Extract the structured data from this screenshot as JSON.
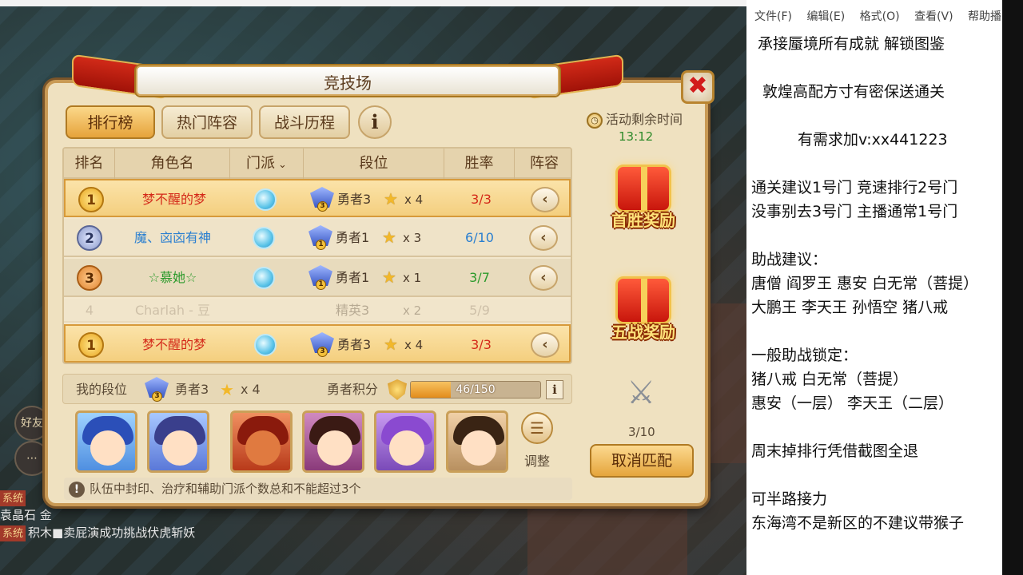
{
  "game": {
    "chat": [
      {
        "tag": "系统",
        "text": ""
      },
      {
        "tag": "",
        "text": "袁晶石 金"
      },
      {
        "tag": "系统",
        "text": "积木■卖屁演成功挑战伏虎斩妖"
      }
    ],
    "side_buttons": [
      "好友"
    ]
  },
  "dialog": {
    "title": "竞技场",
    "close_label": "✖",
    "tabs": [
      {
        "label": "排行榜",
        "active": true
      },
      {
        "label": "热门阵容",
        "active": false
      },
      {
        "label": "战斗历程",
        "active": false
      }
    ],
    "info_label": "i",
    "table": {
      "headers": [
        "排名",
        "角色名",
        "门派",
        "段位",
        "胜率",
        "阵容"
      ],
      "school_sort_icon": "chevron-down-icon",
      "rows": [
        {
          "rank": "1",
          "name": "梦不醒的梦",
          "name_color": "#d42a1a",
          "rank_title": "勇者3",
          "badge": "3",
          "stars": "x  4",
          "winrate": "3/3",
          "winrate_color": "#d42a1a"
        },
        {
          "rank": "2",
          "name": "魔、㐫㐫有神",
          "name_color": "#2a7fd0",
          "rank_title": "勇者1",
          "badge": "1",
          "stars": "x  3",
          "winrate": "6/10",
          "winrate_color": "#2a7fd0"
        },
        {
          "rank": "3",
          "name": "☆慕她☆",
          "name_color": "#2c9a2c",
          "rank_title": "勇者1",
          "badge": "1",
          "stars": "x  1",
          "winrate": "3/7",
          "winrate_color": "#2c9a2c"
        },
        {
          "rank": "4",
          "name": "Charlah - 豆",
          "name_color": "#8a7a66",
          "rank_title": "精英3",
          "badge": "3",
          "stars": "x  2",
          "winrate": "5/9",
          "winrate_color": "#8a7a66"
        }
      ],
      "my_row": {
        "rank": "1",
        "name": "梦不醒的梦",
        "rank_title": "勇者3",
        "badge": "3",
        "stars": "x  4",
        "winrate": "3/3"
      }
    },
    "my_rank": {
      "label": "我的段位",
      "rank_title": "勇者3",
      "stars": "x  4",
      "points_label": "勇者积分",
      "progress_text": "46/150",
      "progress_value": 0.3067,
      "info_label": "i"
    },
    "adjust_label": "调整",
    "tip": "队伍中封印、治疗和辅助门派个数总和不能超过3个",
    "timer_label": "活动剩余时间",
    "timer_value": "13:12",
    "reward_first": "首胜奖励",
    "reward_five": "五战奖励",
    "battle_count": "3/10",
    "cancel_label": "取消匹配",
    "colors": {
      "accent": "#e5a53c",
      "ribbon": "#c8160c",
      "panel": "#efe1c0"
    }
  },
  "notepad": {
    "menu": [
      "文件(F)",
      "编辑(E)",
      "格式(O)",
      "查看(V)",
      "帮助播"
    ],
    "lines": [
      "承接蜃境所有成就  解锁图鉴",
      "",
      "敦煌高配方寸有密保送通关",
      "",
      "有需求加v:xx441223",
      "",
      "通关建议1号门  竞速排行2号门",
      "没事别去3号门  主播通常1号门",
      "",
      "助战建议：",
      "唐僧 阎罗王 惠安 白无常（菩提）",
      "大鹏王 李天王 孙悟空 猪八戒",
      "",
      "一般助战锁定：",
      "猪八戒 白无常（菩提）",
      "惠安（一层）   李天王（二层）",
      "",
      "周末掉排行凭借截图全退",
      "",
      "可半路接力",
      "东海湾不是新区的不建议带猴子"
    ]
  }
}
